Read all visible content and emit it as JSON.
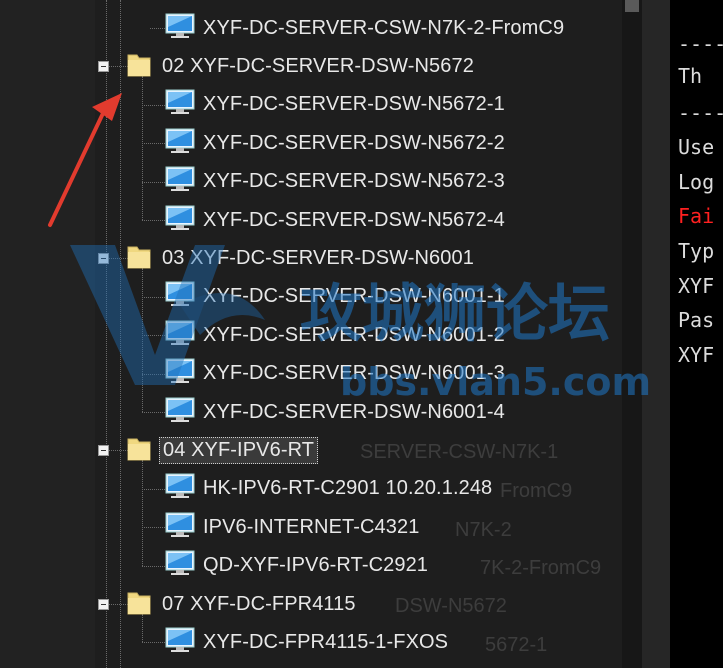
{
  "tree": {
    "top_partial": {
      "label": "XYF-DC-SERVER-CSW-N7K-2-FromC9"
    },
    "folders": [
      {
        "label": "02 XYF-DC-SERVER-DSW-N5672",
        "children": [
          "XYF-DC-SERVER-DSW-N5672-1",
          "XYF-DC-SERVER-DSW-N5672-2",
          "XYF-DC-SERVER-DSW-N5672-3",
          "XYF-DC-SERVER-DSW-N5672-4"
        ]
      },
      {
        "label": "03 XYF-DC-SERVER-DSW-N6001",
        "children": [
          "XYF-DC-SERVER-DSW-N6001-1",
          "XYF-DC-SERVER-DSW-N6001-2",
          "XYF-DC-SERVER-DSW-N6001-3",
          "XYF-DC-SERVER-DSW-N6001-4"
        ]
      },
      {
        "label": "04 XYF-IPV6-RT",
        "selected": true,
        "children": [
          "HK-IPV6-RT-C2901 10.20.1.248",
          "IPV6-INTERNET-C4321",
          "QD-XYF-IPV6-RT-C2921"
        ]
      },
      {
        "label": "07 XYF-DC-FPR4115",
        "children": [
          "XYF-DC-FPR4115-1-FXOS"
        ]
      }
    ],
    "ghost_labels": [
      "SERVER-CSW-N7K-1",
      "FromC9",
      "N7K-2",
      "7K-2-FromC9",
      "DSW-N5672",
      "5672-1"
    ]
  },
  "terminal": {
    "lines": [
      {
        "text": "----",
        "color": "normal"
      },
      {
        "text": " Th",
        "color": "normal"
      },
      {
        "text": "----",
        "color": "normal"
      },
      {
        "text": "Use",
        "color": "normal"
      },
      {
        "text": "Log",
        "color": "normal"
      },
      {
        "text": "Fai",
        "color": "error"
      },
      {
        "text": "Typ",
        "color": "normal"
      },
      {
        "text": "XYF",
        "color": "normal"
      },
      {
        "text": "Pas",
        "color": "normal"
      },
      {
        "text": "XYF",
        "color": "normal"
      }
    ]
  },
  "watermark": {
    "title": "攻城狮论坛",
    "url": "bbs.vlan5.com"
  },
  "colors": {
    "folder": "#f0d880",
    "terminal_error": "#ff2020",
    "arrow": "#e23b2e"
  },
  "icons": {
    "folder": "folder-icon",
    "session": "monitor-icon",
    "collapse": "collapse-toggle-icon"
  }
}
